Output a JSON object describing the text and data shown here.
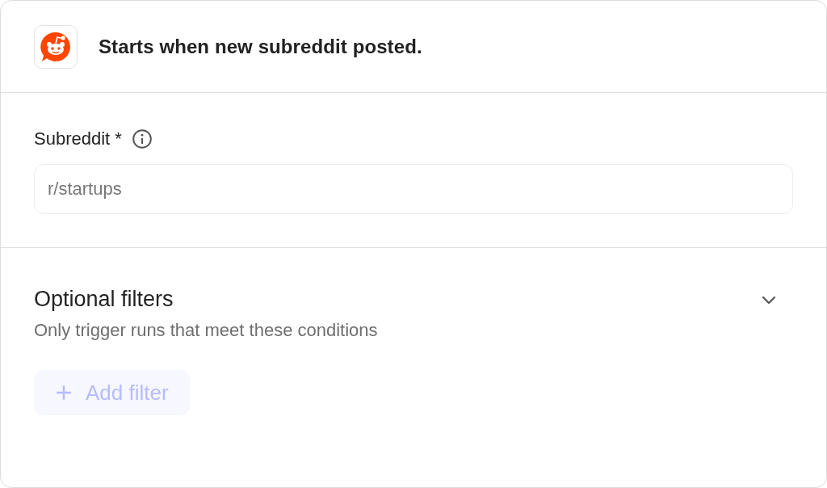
{
  "header": {
    "title": "Starts when new subreddit posted."
  },
  "subreddit_field": {
    "label": "Subreddit *",
    "placeholder": "r/startups"
  },
  "optional_filters": {
    "title": "Optional filters",
    "subtitle": "Only trigger runs that meet these conditions",
    "add_button": {
      "label": "Add filter",
      "disabled": true
    }
  }
}
